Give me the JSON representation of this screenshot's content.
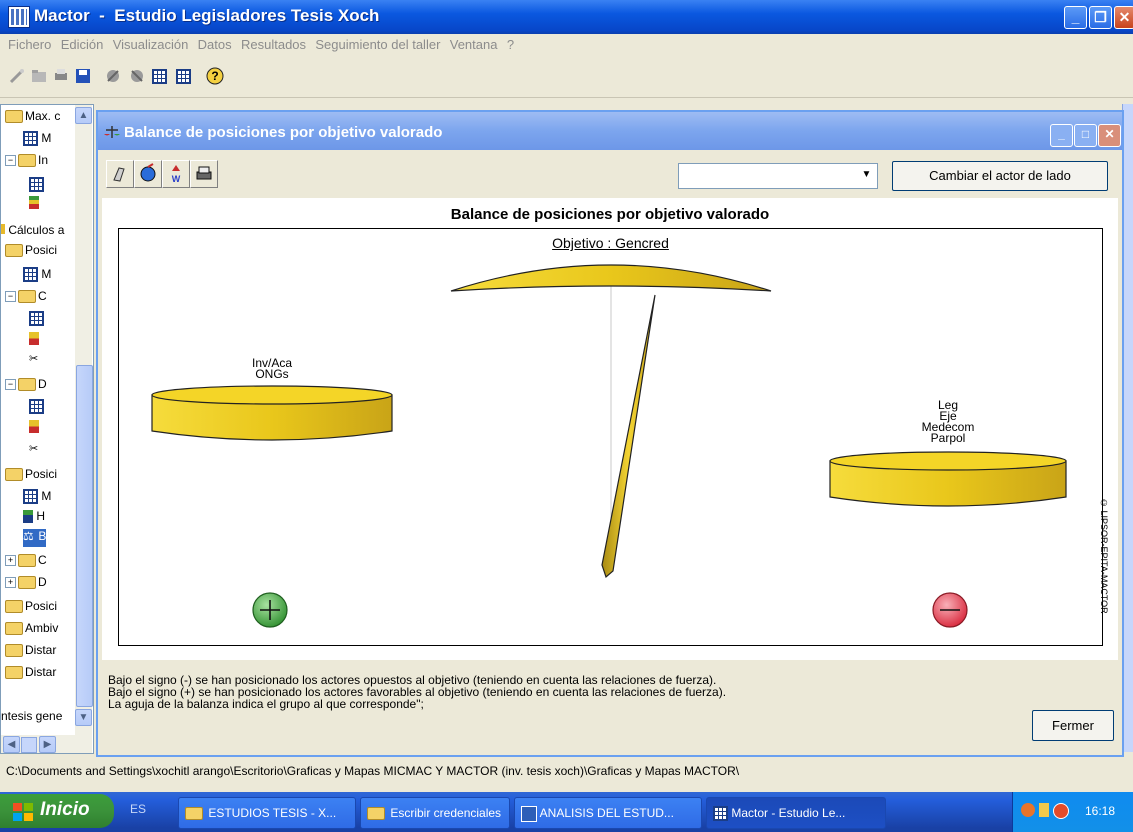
{
  "window": {
    "app_name": "Mactor",
    "separator": "-",
    "title": "Estudio Legisladores Tesis Xoch",
    "title_full": "Mactor  -  Estudio Legisladores Tesis Xoch"
  },
  "menu": [
    "Fichero",
    "Edición",
    "Visualización",
    "Datos",
    "Resultados",
    "Seguimiento del taller",
    "Ventana",
    "?"
  ],
  "tree": {
    "items": [
      {
        "label": "Max. c"
      },
      {
        "label": "M"
      },
      {
        "label": "In"
      },
      {
        "label": "Cálculos a"
      },
      {
        "label": "Posici"
      },
      {
        "label": "M"
      },
      {
        "label": "C"
      },
      {
        "label": "D"
      },
      {
        "label": "Posici"
      },
      {
        "label": "M"
      },
      {
        "label": "H"
      },
      {
        "label": "B"
      },
      {
        "label": "C"
      },
      {
        "label": "D"
      },
      {
        "label": "Posici"
      },
      {
        "label": "Ambiv"
      },
      {
        "label": "Distar"
      },
      {
        "label": "Distar"
      },
      {
        "label": "ntesis gene"
      }
    ]
  },
  "inner_window": {
    "title": "Balance de posiciones por objetivo valorado",
    "combo_value": "",
    "swap_button": "Cambiar el actor de lado"
  },
  "chart": {
    "title": "Balance de posiciones por objetivo valorado",
    "objective": "Objetivo : Gencred",
    "left_actors": [
      "Inv/Aca",
      "ONGs"
    ],
    "right_actors": [
      "Leg",
      "Eje",
      "Medecom",
      "Parpol"
    ],
    "favorable_side": "left",
    "needle_points_to": "left",
    "plus_sign": "+",
    "minus_sign": "−",
    "copyright": "© LIPSOR-EPITA-MACTOR"
  },
  "notes": [
    "Bajo el signo (-) se han posicionado los actores opuestos al objetivo (teniendo en cuenta las relaciones de fuerza).",
    "Bajo el signo (+) se han posicionado los actores favorables al objetivo (teniendo en cuenta las relaciones de fuerza).",
    "La aguja de la balanza indica el grupo al que corresponde\";"
  ],
  "close_button": "Fermer",
  "status_path": "C:\\Documents and Settings\\xochitl arango\\Escritorio\\Graficas y Mapas MICMAC Y MACTOR (inv. tesis xoch)\\Graficas y Mapas MACTOR\\",
  "taskbar": {
    "start": "Inicio",
    "lang": "ES",
    "items": [
      {
        "label": "ESTUDIOS TESIS - X..."
      },
      {
        "label": "Escribir credenciales"
      },
      {
        "label": "ANALISIS DEL ESTUD..."
      },
      {
        "label": "Mactor  -  Estudio Le..."
      }
    ],
    "clock": "16:18"
  },
  "colors": {
    "xp_blue": "#0a58e0",
    "plate_yellow": "#f2d21c",
    "plus_green": "#3a9a3a",
    "minus_red": "#d8263a"
  }
}
